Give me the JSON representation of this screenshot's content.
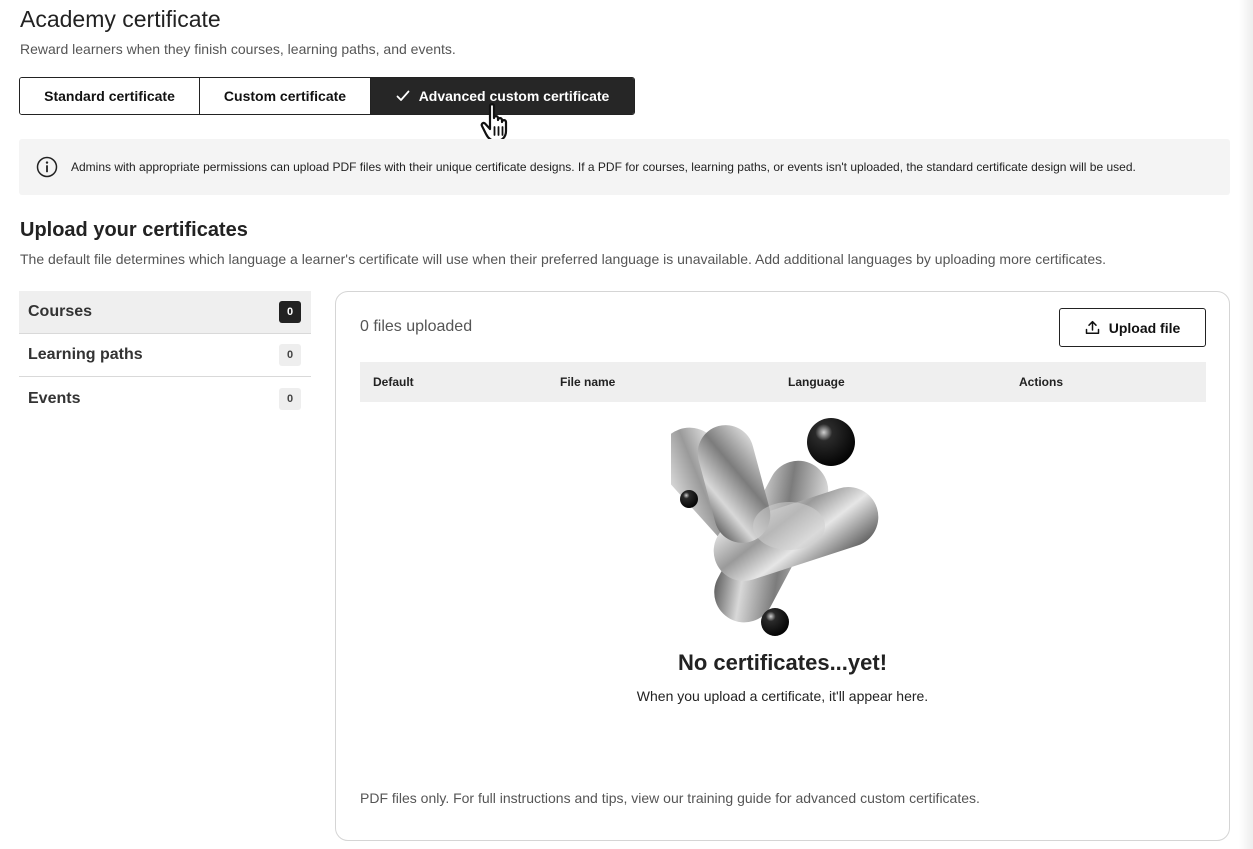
{
  "header": {
    "title": "Academy certificate",
    "subtitle": "Reward learners when they finish courses, learning paths, and events."
  },
  "certificate_type": {
    "options": [
      {
        "label": "Standard certificate",
        "selected": false
      },
      {
        "label": "Custom certificate",
        "selected": false
      },
      {
        "label": "Advanced custom certificate",
        "selected": true
      }
    ]
  },
  "info": {
    "text": "Admins with appropriate permissions can upload PDF files with their unique certificate designs. If a PDF for courses, learning paths, or events isn't uploaded, the standard certificate design will be used."
  },
  "upload_section": {
    "title": "Upload your certificates",
    "description": "The default file determines which language a learner's certificate will use when their preferred language is unavailable. Add additional languages by uploading more certificates."
  },
  "sidebar": {
    "items": [
      {
        "label": "Courses",
        "count": "0",
        "active": true
      },
      {
        "label": "Learning paths",
        "count": "0",
        "active": false
      },
      {
        "label": "Events",
        "count": "0",
        "active": false
      }
    ]
  },
  "panel": {
    "files_count": "0 files uploaded",
    "upload_button": "Upload file",
    "table_headers": [
      "Default",
      "File name",
      "Language",
      "Actions"
    ],
    "empty_title": "No certificates...yet!",
    "empty_subtitle": "When you upload a certificate, it'll appear here.",
    "footnote": "PDF files only. For full instructions and tips, view our training guide for advanced custom certificates."
  },
  "icons": {
    "check": "check-icon",
    "info": "info-icon",
    "upload": "upload-icon",
    "cursor": "hand-pointer-icon"
  },
  "colors": {
    "selected_bg": "#262626",
    "info_bg": "#f4f4f4",
    "table_header_bg": "#efefef",
    "border": "#222222"
  }
}
